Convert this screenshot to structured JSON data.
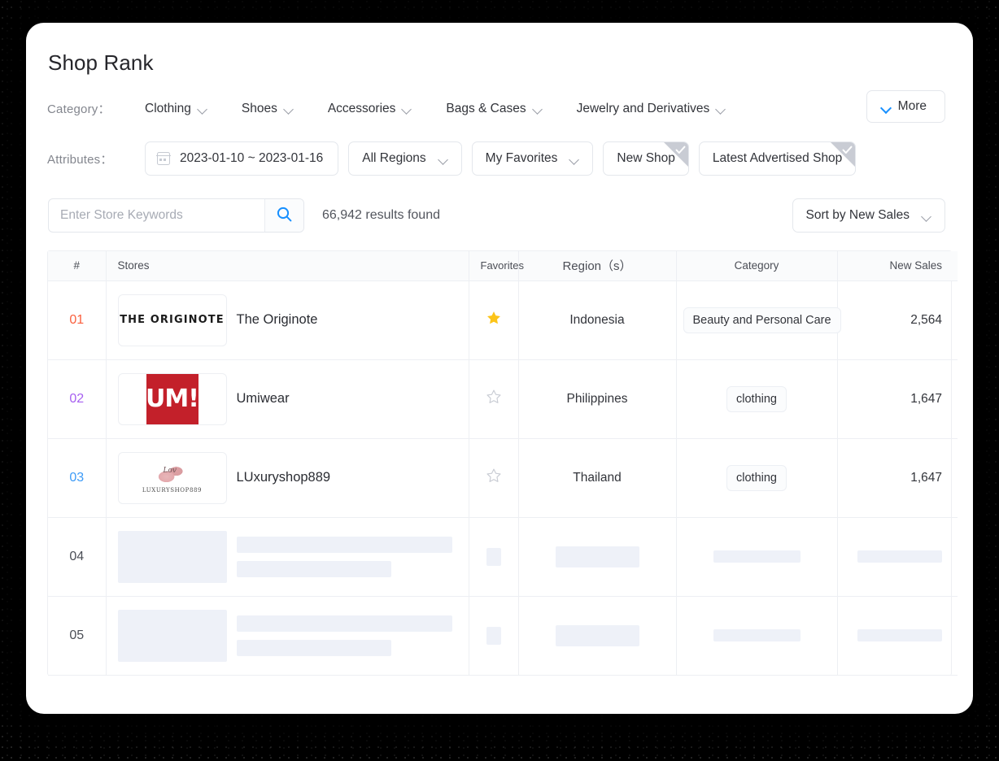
{
  "page": {
    "title": "Shop Rank"
  },
  "category_filter": {
    "label": "Category：",
    "items": [
      {
        "label": "Clothing"
      },
      {
        "label": "Shoes"
      },
      {
        "label": "Accessories"
      },
      {
        "label": "Bags & Cases"
      },
      {
        "label": "Jewelry and Derivatives"
      }
    ],
    "more_label": "More"
  },
  "attributes_filter": {
    "label": "Attributes：",
    "date_range": "2023-01-10 ~ 2023-01-16",
    "region": "All Regions",
    "favorites": "My Favorites",
    "new_shop": "New Shop",
    "latest_advertised": "Latest Advertised Shop"
  },
  "search": {
    "placeholder": "Enter Store Keywords",
    "value": "",
    "results_text": "66,942 results found",
    "sort_label": "Sort by New Sales"
  },
  "table": {
    "headers": {
      "rank": "#",
      "stores": "Stores",
      "favorites": "Favorites",
      "region": "Region（s）",
      "category": "Category",
      "new_sales": "New Sales"
    },
    "rows": [
      {
        "rank": "01",
        "store": "The Originote",
        "logo_text": "THE ORIGINOTE",
        "favorited": true,
        "region": "Indonesia",
        "category": "Beauty and Personal Care",
        "new_sales": "2,564"
      },
      {
        "rank": "02",
        "store": "Umiwear",
        "logo_text": "UM!",
        "favorited": false,
        "region": "Philippines",
        "category": "clothing",
        "new_sales": "1,647"
      },
      {
        "rank": "03",
        "store": "LUxuryshop889",
        "logo_text": "LUXURYSHOP889",
        "favorited": false,
        "region": "Thailand",
        "category": "clothing",
        "new_sales": "1,647"
      },
      {
        "rank": "04",
        "store": "",
        "logo_text": "",
        "favorited": false,
        "region": "",
        "category": "",
        "new_sales": ""
      },
      {
        "rank": "05",
        "store": "",
        "logo_text": "",
        "favorited": false,
        "region": "",
        "category": "",
        "new_sales": ""
      }
    ]
  },
  "colors": {
    "rank_1": "#fa5f3d",
    "rank_2": "#a65ff0",
    "rank_3": "#3d9bf7",
    "accent_blue": "#1890ff",
    "star_gold": "#fcc419",
    "umi_red": "#c3202a",
    "skeleton": "#eef1f8"
  }
}
